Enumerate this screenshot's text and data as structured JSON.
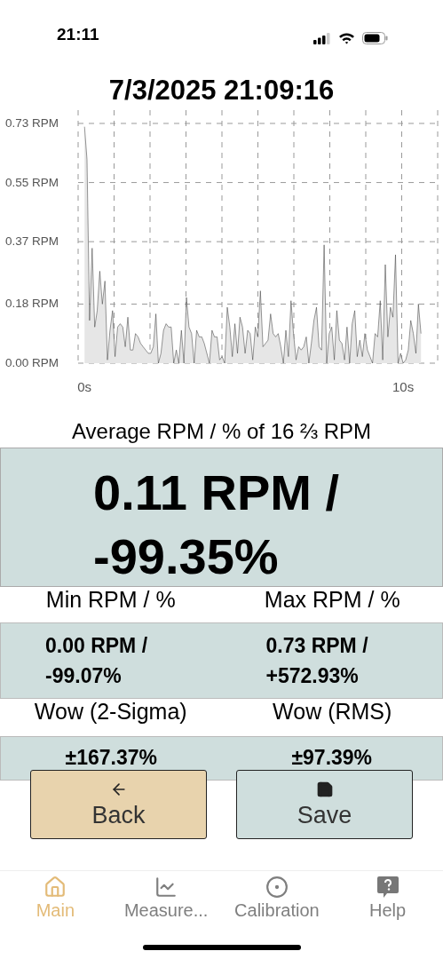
{
  "status_bar": {
    "time": "21:11"
  },
  "title": "7/3/2025 21:09:16",
  "chart": {
    "chart_data": {
      "type": "area",
      "grid": true,
      "xlim": [
        -0.2,
        11
      ],
      "ylim": [
        0,
        0.73
      ],
      "x": [
        0,
        0.08,
        0.16,
        0.24,
        0.32,
        0.4,
        0.48,
        0.56,
        0.64,
        0.72,
        0.8,
        0.88,
        0.96,
        1.04,
        1.12,
        1.2,
        1.28,
        1.36,
        1.44,
        1.52,
        1.6,
        1.68,
        1.76,
        1.84,
        1.92,
        2,
        2.08,
        2.16,
        2.24,
        2.32,
        2.4,
        2.48,
        2.56,
        2.64,
        2.72,
        2.8,
        2.88,
        2.96,
        3.04,
        3.12,
        3.2,
        3.28,
        3.36,
        3.44,
        3.52,
        3.6,
        3.68,
        3.76,
        3.84,
        3.92,
        4,
        4.08,
        4.16,
        4.24,
        4.32,
        4.4,
        4.48,
        4.56,
        4.64,
        4.72,
        4.8,
        4.88,
        4.96,
        5.04,
        5.12,
        5.2,
        5.28,
        5.36,
        5.44,
        5.52,
        5.6,
        5.68,
        5.76,
        5.84,
        5.92,
        6,
        6.08,
        6.16,
        6.24,
        6.32,
        6.4,
        6.48,
        6.56,
        6.64,
        6.72,
        6.8,
        6.88,
        6.96,
        7.04,
        7.12,
        7.2,
        7.28,
        7.36,
        7.44,
        7.52,
        7.6,
        7.68,
        7.76,
        7.84,
        7.92,
        8,
        8.08,
        8.16,
        8.24,
        8.32,
        8.4,
        8.48,
        8.56,
        8.64,
        8.72,
        8.8,
        8.88,
        8.96,
        9.04,
        9.12,
        9.2,
        9.28,
        9.36,
        9.44,
        9.52,
        9.6,
        9.68,
        9.76,
        9.84,
        9.92,
        10,
        10.08,
        10.16,
        10.24,
        10.32,
        10.4,
        10.48,
        10.56
      ],
      "yticks": [
        {
          "value": 0,
          "label": "0.00 RPM"
        },
        {
          "value": 0.18,
          "label": "0.18 RPM"
        },
        {
          "value": 0.37,
          "label": "0.37 RPM"
        },
        {
          "value": 0.55,
          "label": "0.55 RPM"
        },
        {
          "value": 0.73,
          "label": "0.73 RPM"
        }
      ],
      "xticks": [
        {
          "value": 0,
          "label": "0s"
        },
        {
          "value": 10,
          "label": "10s"
        }
      ],
      "series": [
        {
          "color": "#e6e6e6",
          "values": [
            0.72,
            0.62,
            0.13,
            0.35,
            0.11,
            0.16,
            0.28,
            0.18,
            0.25,
            0.01,
            0.1,
            0.16,
            0.02,
            0.11,
            0.12,
            0.11,
            0.05,
            0.14,
            0.04,
            0.04,
            0.09,
            0.08,
            0.06,
            0.05,
            0.04,
            0.03,
            0.03,
            0.05,
            0.15,
            0,
            0.03,
            0.1,
            0.12,
            0.11,
            0.11,
            0,
            0.04,
            0,
            0.1,
            0,
            0.2,
            0.11,
            0.09,
            0,
            0.1,
            0.08,
            0.08,
            0.06,
            0.03,
            0,
            0.1,
            0.08,
            0.08,
            0.01,
            0.02,
            0,
            0.17,
            0.11,
            0.02,
            0.12,
            0.03,
            0.14,
            0.11,
            0.03,
            0.1,
            0.09,
            0.01,
            0.11,
            0.08,
            0.22,
            0.05,
            0.06,
            0.07,
            0.15,
            0.09,
            0.08,
            0.09,
            0.05,
            0,
            0.1,
            0.02,
            0.19,
            0.09,
            0.01,
            0.05,
            0.04,
            0.05,
            0.08,
            0,
            0.06,
            0.13,
            0.17,
            0.05,
            0.04,
            0.36,
            0,
            0.09,
            0.11,
            0.01,
            0.16,
            0.07,
            0.06,
            0.01,
            0.11,
            0,
            0.12,
            0.16,
            0.02,
            0.07,
            0.02,
            0.09,
            0.04,
            0.02,
            0,
            0.09,
            0.08,
            0.19,
            0.01,
            0.3,
            0.08,
            0.17,
            0.14,
            0.33,
            0,
            0.03,
            0,
            0.01,
            0.04,
            0.13,
            0.09,
            0.03,
            0.18,
            0.09
          ]
        }
      ]
    }
  },
  "average": {
    "label": "Average RPM / % of 16 ⅔ RPM",
    "value": "0.11 RPM / -99.35%"
  },
  "stats": [
    {
      "label": "Min RPM / %",
      "value": "0.00 RPM / -99.07%"
    },
    {
      "label": "Max RPM / %",
      "value": "0.73 RPM / +572.93%"
    }
  ],
  "wow": [
    {
      "label": "Wow (2-Sigma)",
      "value": "±167.37%"
    },
    {
      "label": "Wow (RMS)",
      "value": "±97.39%"
    }
  ],
  "buttons": [
    {
      "kind": "back",
      "label": "Back"
    },
    {
      "kind": "save",
      "label": "Save"
    }
  ],
  "tabs": [
    {
      "kind": "home",
      "label": "Main",
      "selected": true
    },
    {
      "kind": "chart",
      "label": "Measure...",
      "selected": false
    },
    {
      "kind": "target",
      "label": "Calibration",
      "selected": false
    },
    {
      "kind": "help",
      "label": "Help",
      "selected": false
    }
  ]
}
